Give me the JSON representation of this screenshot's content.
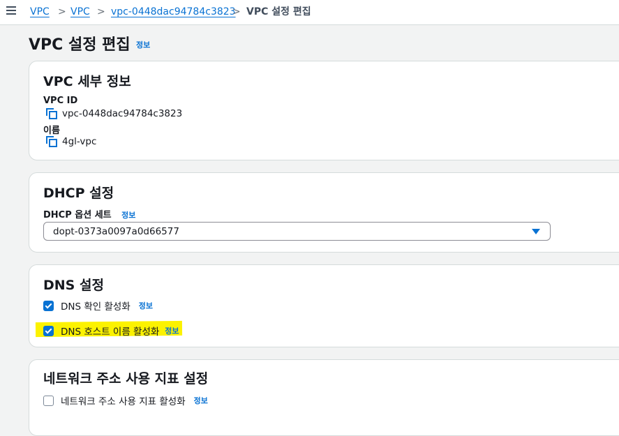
{
  "breadcrumb": {
    "items": [
      "VPC",
      "VPC",
      "vpc-0448dac94784c3823"
    ],
    "current": "VPC 설정 편집",
    "separator": ">"
  },
  "page": {
    "title": "VPC 설정 편집",
    "info_label": "정보"
  },
  "vpc_details": {
    "title": "VPC 세부 정보",
    "vpc_id_label": "VPC ID",
    "vpc_id_value": "vpc-0448dac94784c3823",
    "name_label": "이름",
    "name_value": "4gl-vpc"
  },
  "dhcp": {
    "title": "DHCP 설정",
    "option_set_label": "DHCP 옵션 세트",
    "info_label": "정보",
    "selected_value": "dopt-0373a0097a0d66577"
  },
  "dns": {
    "title": "DNS 설정",
    "resolution_label": "DNS 확인 활성화",
    "resolution_checked": true,
    "hostnames_label": "DNS 호스트 이름 활성화",
    "hostnames_checked": true,
    "info_label": "정보",
    "highlight_color": "#fcf200"
  },
  "network_metrics": {
    "title": "네트워크 주소 사용 지표 설정",
    "enable_label": "네트워크 주소 사용 지표 활성화",
    "enable_checked": false,
    "info_label": "정보"
  },
  "colors": {
    "link": "#0972d3",
    "text": "#16191f",
    "background": "#f2f3f3"
  }
}
